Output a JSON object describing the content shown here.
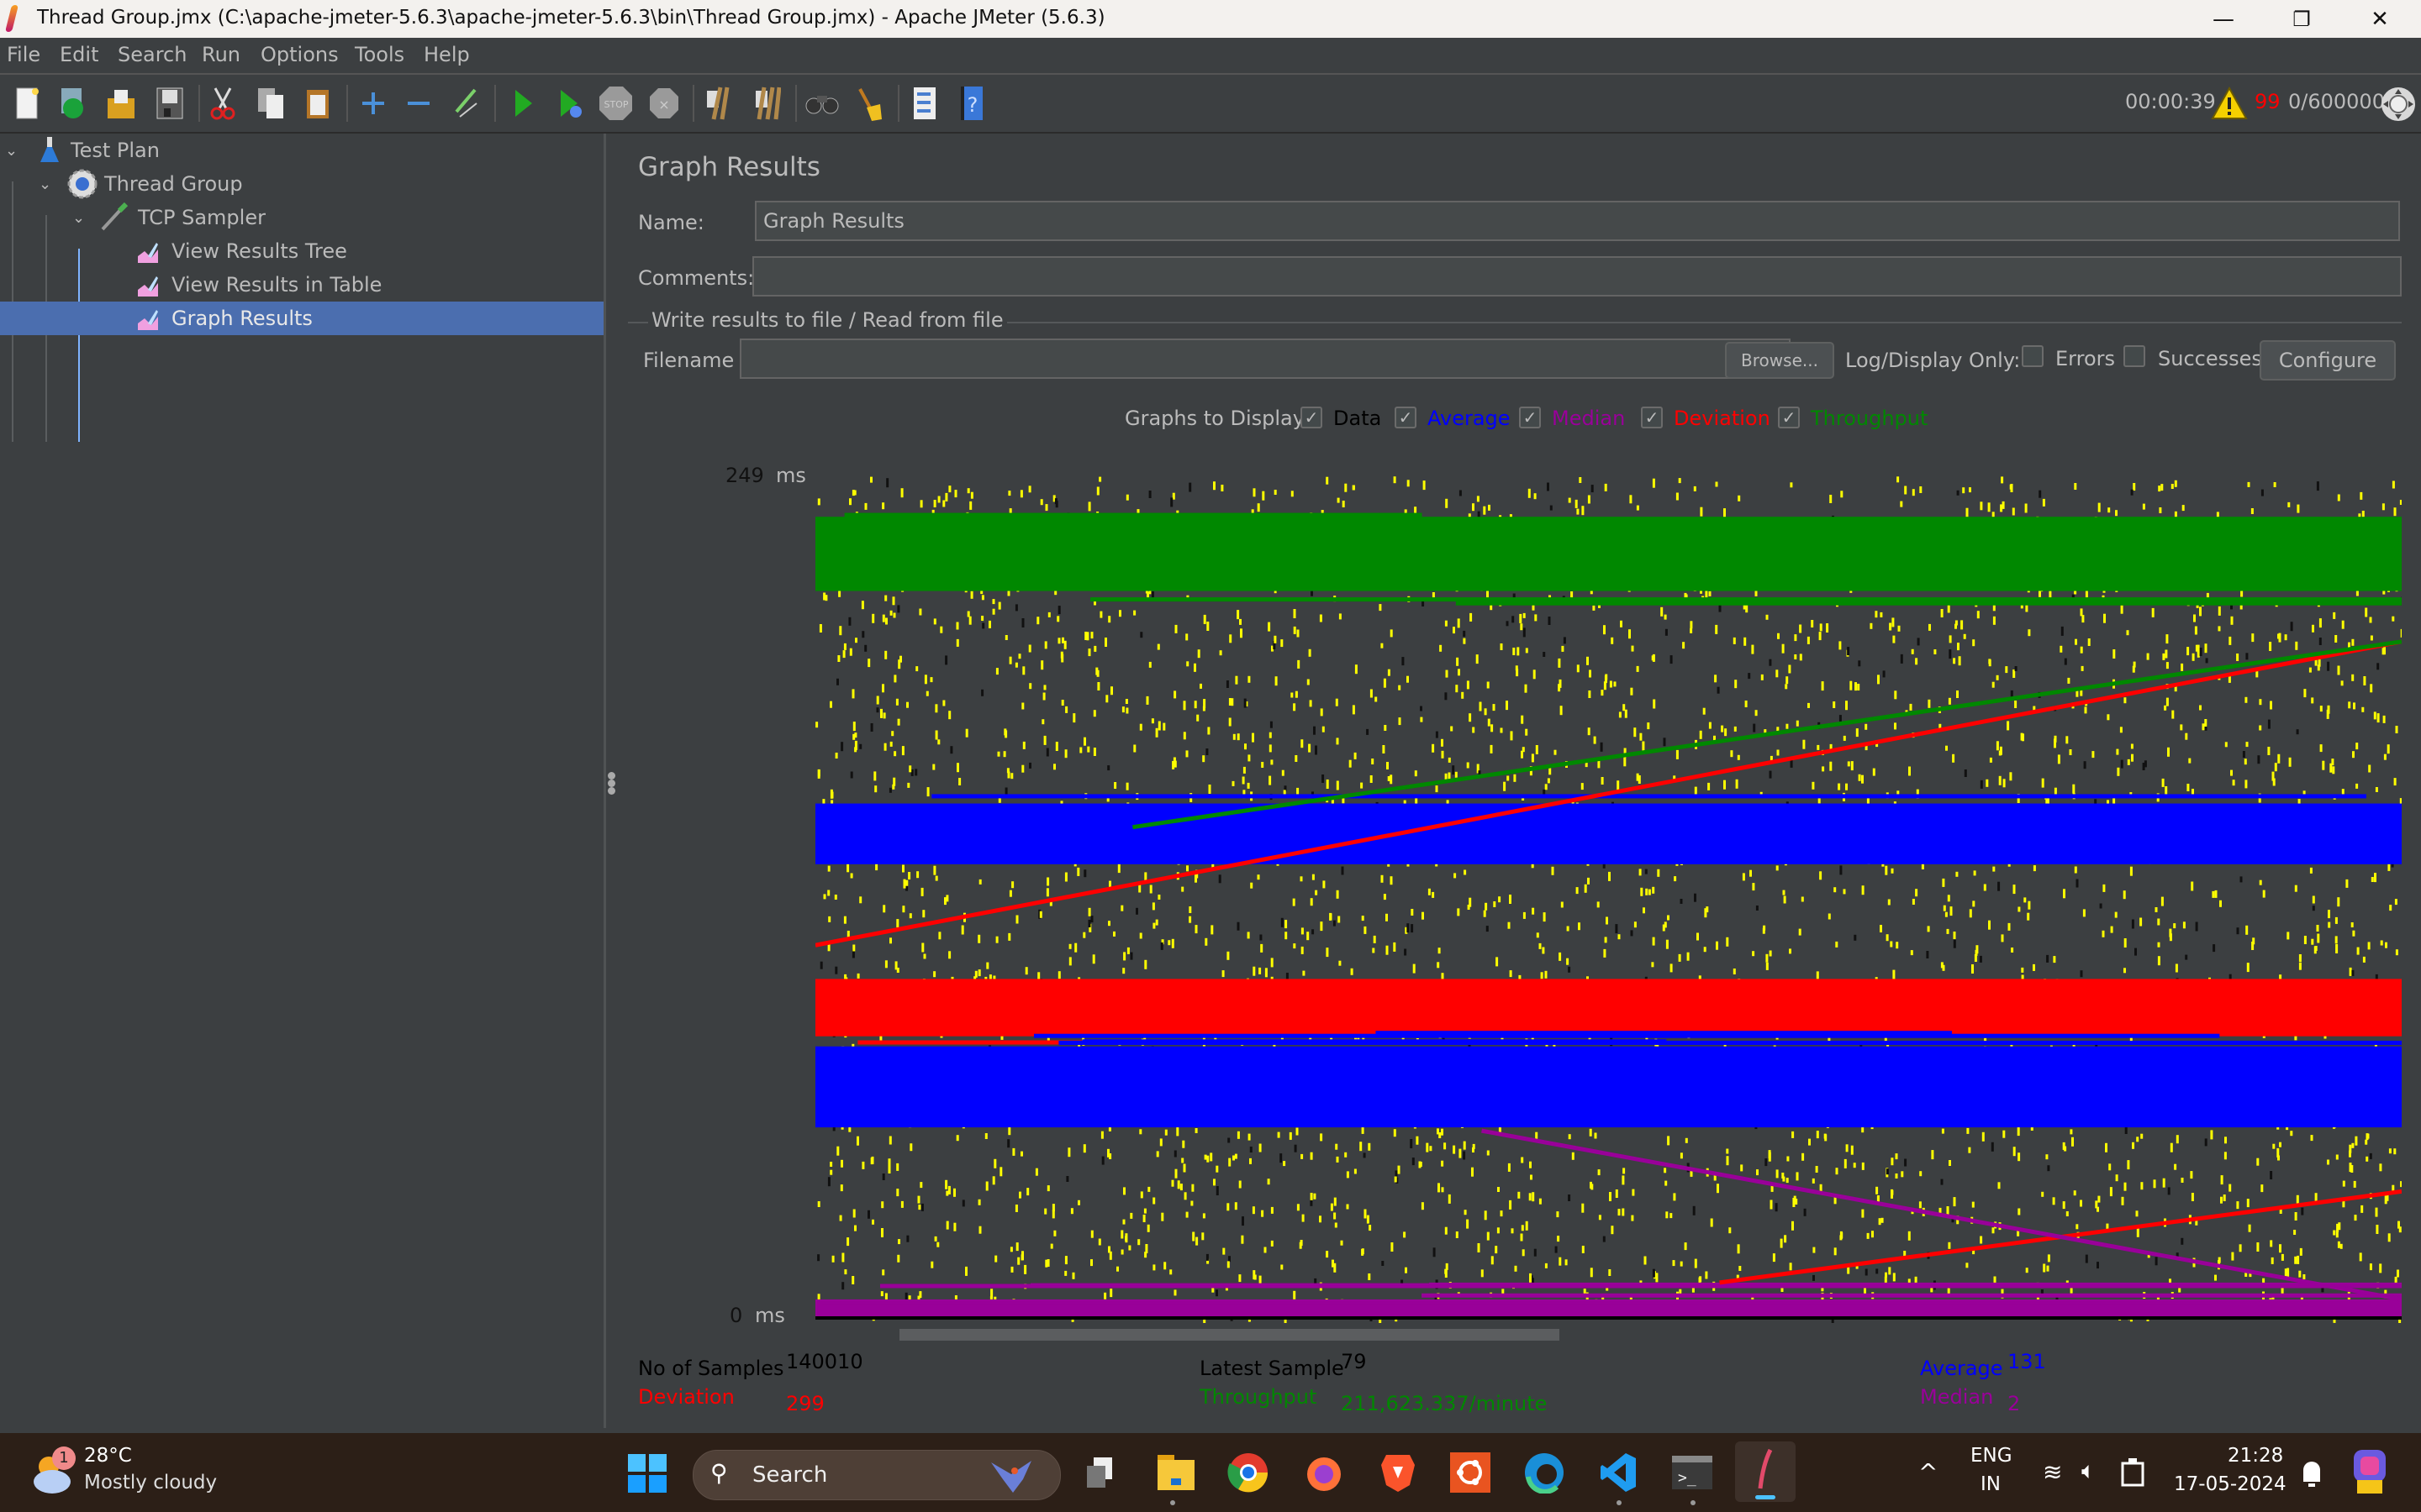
{
  "window": {
    "title": "Thread Group.jmx (C:\\apache-jmeter-5.6.3\\apache-jmeter-5.6.3\\bin\\Thread Group.jmx) - Apache JMeter (5.6.3)",
    "minimize": "—",
    "restore": "❐",
    "close": "✕"
  },
  "menu": [
    "File",
    "Edit",
    "Search",
    "Run",
    "Options",
    "Tools",
    "Help"
  ],
  "toolbar": {
    "buttons": [
      {
        "name": "new-icon"
      },
      {
        "name": "templates-icon"
      },
      {
        "name": "open-icon"
      },
      {
        "name": "save-icon"
      },
      {
        "name": "cut-icon"
      },
      {
        "name": "copy-icon"
      },
      {
        "name": "paste-icon"
      },
      {
        "name": "expand-all-icon"
      },
      {
        "name": "collapse-all-icon"
      },
      {
        "name": "toggle-icon"
      },
      {
        "name": "start-icon"
      },
      {
        "name": "start-no-pause-icon"
      },
      {
        "name": "stop-icon"
      },
      {
        "name": "shutdown-icon"
      },
      {
        "name": "clear-icon"
      },
      {
        "name": "clear-all-icon"
      },
      {
        "name": "search-icon"
      },
      {
        "name": "reset-search-icon"
      },
      {
        "name": "function-helper-icon"
      },
      {
        "name": "help-icon"
      }
    ],
    "elapsed_time": "00:00:39",
    "warning_count": "99",
    "threads": "0/600000"
  },
  "tree": {
    "items": [
      {
        "label": "Test Plan",
        "level": 0,
        "icon": "test-plan-icon",
        "expanded": true
      },
      {
        "label": "Thread Group",
        "level": 1,
        "icon": "thread-group-icon",
        "expanded": true
      },
      {
        "label": "TCP Sampler",
        "level": 2,
        "icon": "sampler-icon",
        "expanded": true
      },
      {
        "label": "View Results Tree",
        "level": 3,
        "icon": "listener-icon"
      },
      {
        "label": "View Results in Table",
        "level": 3,
        "icon": "listener-icon"
      },
      {
        "label": "Graph Results",
        "level": 3,
        "icon": "listener-icon",
        "selected": true
      }
    ]
  },
  "panel": {
    "heading": "Graph Results",
    "name_label": "Name:",
    "name_value": "Graph Results",
    "comments_label": "Comments:",
    "comments_value": "",
    "file_section_title": "Write results to file / Read from file",
    "filename_label": "Filename",
    "filename_value": "",
    "browse_label": "Browse...",
    "log_display_label": "Log/Display Only:",
    "errors_label": "Errors",
    "errors_checked": false,
    "successes_label": "Successes",
    "successes_checked": false,
    "configure_label": "Configure",
    "graphs_to_display_label": "Graphs to Display",
    "check_mark": "✓",
    "graph_toggles": [
      {
        "label": "Data",
        "checked": true,
        "color": "#000000"
      },
      {
        "label": "Average",
        "checked": true,
        "color": "#0000ff"
      },
      {
        "label": "Median",
        "checked": true,
        "color": "#990099"
      },
      {
        "label": "Deviation",
        "checked": true,
        "color": "#ff0000"
      },
      {
        "label": "Throughput",
        "checked": true,
        "color": "#008800"
      }
    ]
  },
  "chart_data": {
    "type": "scatter",
    "title": "",
    "ylabel": "ms",
    "y_max_label": "249",
    "y_min_label": "0",
    "y_unit": "ms",
    "ylim": [
      0,
      249
    ],
    "series": [
      {
        "name": "Data",
        "color": "#ffff00",
        "note": "dense scatter of individual sample times"
      },
      {
        "name": "Average",
        "color": "#0000ff"
      },
      {
        "name": "Median",
        "color": "#990099"
      },
      {
        "name": "Deviation",
        "color": "#ff0000"
      },
      {
        "name": "Throughput",
        "color": "#008800"
      }
    ],
    "bands": [
      {
        "series": "Throughput",
        "y_from": 215,
        "y_to": 237
      },
      {
        "series": "Average",
        "y_from": 134,
        "y_to": 152
      },
      {
        "series": "Deviation",
        "y_from": 83,
        "y_to": 100
      },
      {
        "series": "Average",
        "y_from": 56,
        "y_to": 80
      },
      {
        "series": "Median",
        "y_from": 0,
        "y_to": 5
      }
    ],
    "trend_lines": [
      {
        "series": "Deviation",
        "from": [
          0,
          110
        ],
        "to": [
          1,
          200
        ]
      },
      {
        "series": "Deviation",
        "from": [
          0.57,
          10
        ],
        "to": [
          1,
          37
        ]
      },
      {
        "series": "Median",
        "from": [
          0.42,
          55
        ],
        "to": [
          1,
          5
        ]
      },
      {
        "series": "Throughput",
        "from": [
          0.2,
          145
        ],
        "to": [
          1,
          200
        ]
      }
    ]
  },
  "summary": {
    "samples_label": "No of Samples",
    "samples_value": "140010",
    "latest_label": "Latest Sample",
    "latest_value": "79",
    "average_label": "Average",
    "average_value": "131",
    "deviation_label": "Deviation",
    "deviation_value": "299",
    "throughput_label": "Throughput",
    "throughput_value": "211,623.337/minute",
    "median_label": "Median",
    "median_value": "2",
    "colors": {
      "samples": "#000000",
      "average": "#0000ff",
      "deviation": "#ff0000",
      "throughput": "#008800",
      "median": "#990099"
    }
  },
  "taskbar": {
    "weather_badge": "1",
    "temperature": "28°C",
    "weather_desc": "Mostly cloudy",
    "search_placeholder": "Search",
    "apps": [
      "task-view",
      "file-explorer",
      "chrome",
      "firefox",
      "brave",
      "ubuntu",
      "edge",
      "vscode",
      "terminal",
      "jmeter"
    ],
    "chevron": "^",
    "language": "ENG",
    "region": "IN",
    "time": "21:28",
    "date": "17-05-2024"
  }
}
